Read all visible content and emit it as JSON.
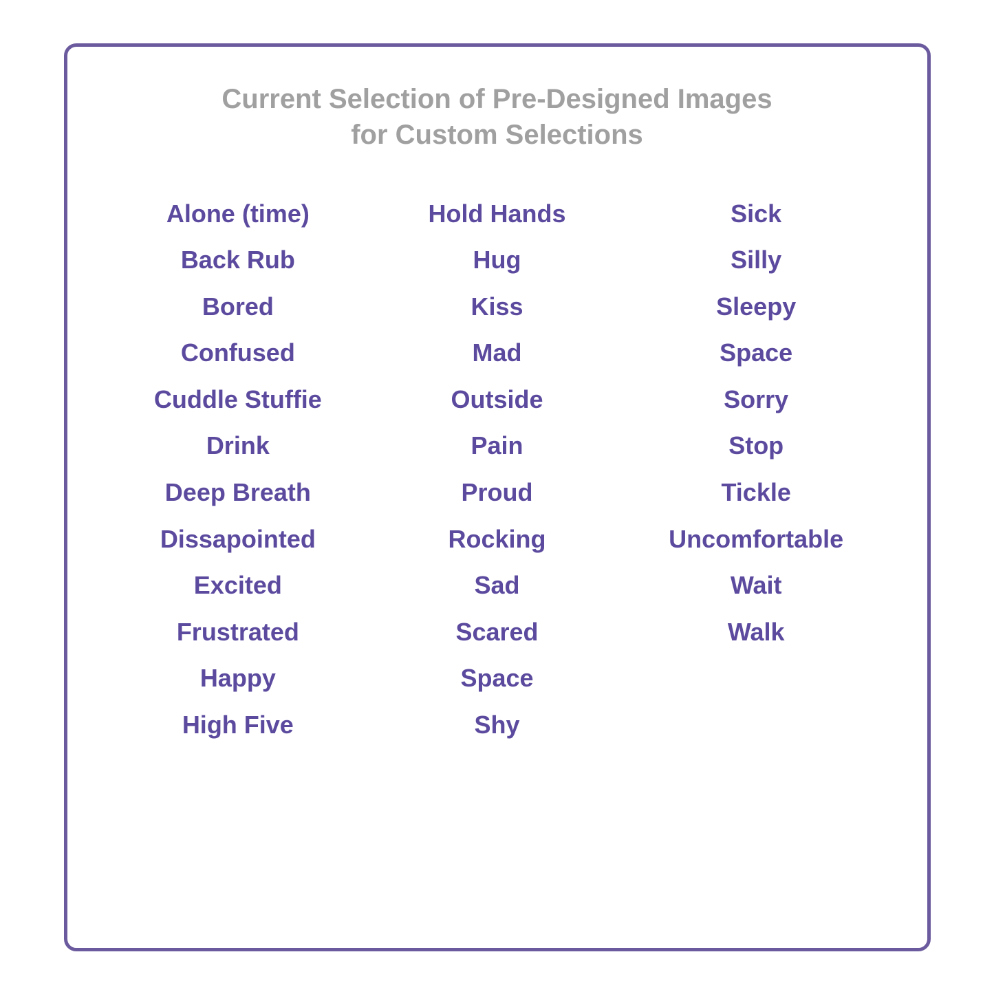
{
  "title": {
    "line1": "Current Selection of Pre-Designed Images",
    "line2": "for Custom Selections"
  },
  "columns": {
    "col1": {
      "items": [
        "Alone (time)",
        "Back Rub",
        "Bored",
        "Confused",
        "Cuddle Stuffie",
        "Drink",
        "Deep Breath",
        "Dissapointed",
        "Excited",
        "Frustrated",
        "Happy",
        "High Five"
      ]
    },
    "col2": {
      "items": [
        "Hold Hands",
        "Hug",
        "Kiss",
        "Mad",
        "Outside",
        "Pain",
        "Proud",
        "Rocking",
        "Sad",
        "Scared",
        "Space",
        "Shy"
      ]
    },
    "col3": {
      "items": [
        "Sick",
        "Silly",
        "Sleepy",
        "Space",
        "Sorry",
        "Stop",
        "Tickle",
        "Uncomfortable",
        "Wait",
        "Walk"
      ]
    }
  }
}
